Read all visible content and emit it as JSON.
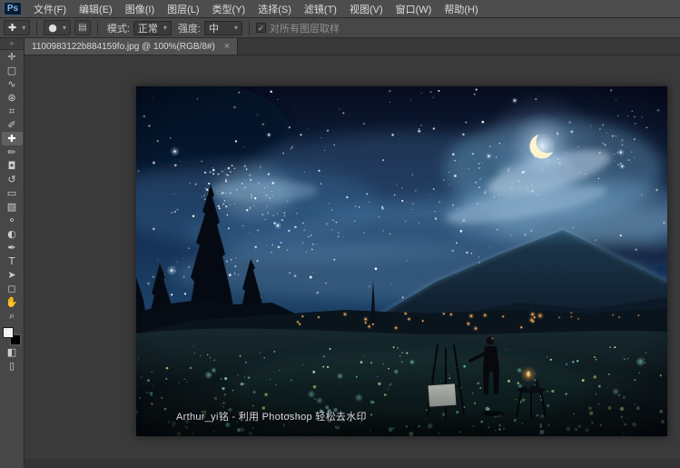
{
  "app": {
    "name": "Adobe Photoshop",
    "logo": "Ps"
  },
  "colors": {
    "menubar": "#4d4d4d",
    "panel": "#474747",
    "pasteboard": "#3a3a3a",
    "accent_blue": "#7ab8f5",
    "night_sky": "#12294d",
    "moon": "#fef3cf",
    "village_light": "#ffb160",
    "flower_teal": "#7fd8c4"
  },
  "menubar": {
    "items": [
      {
        "id": "file",
        "label": "文件(F)"
      },
      {
        "id": "edit",
        "label": "编辑(E)"
      },
      {
        "id": "image",
        "label": "图像(I)"
      },
      {
        "id": "layer",
        "label": "图层(L)"
      },
      {
        "id": "type",
        "label": "类型(Y)"
      },
      {
        "id": "select",
        "label": "选择(S)"
      },
      {
        "id": "filter",
        "label": "滤镜(T)"
      },
      {
        "id": "view",
        "label": "视图(V)"
      },
      {
        "id": "window",
        "label": "窗口(W)"
      },
      {
        "id": "help",
        "label": "帮助(H)"
      }
    ]
  },
  "optionsbar": {
    "preset_glyph": "✚",
    "chevron_glyph": "▾",
    "brush_picker_glyph": "●",
    "panel_toggle_glyph": "▤",
    "mode_label": "模式:",
    "mode_value": "正常",
    "strength_label": "强度:",
    "strength_value": "中",
    "check_glyph": "✓",
    "sample_check_label": "对所有图层取样"
  },
  "tabbar": {
    "title": "1100983122b884159fo.jpg @ 100%(RGB/8#)",
    "close_glyph": "×"
  },
  "toolbar": {
    "collapse_glyph": "»",
    "quick_mask_glyph": "◧",
    "screen_mode_glyph": "▯",
    "tools": [
      {
        "id": "move-tool",
        "glyph": "✛"
      },
      {
        "id": "marquee-tool",
        "glyph": "▢"
      },
      {
        "id": "lasso-tool",
        "glyph": "∿"
      },
      {
        "id": "quick-selection-tool",
        "glyph": "⊛"
      },
      {
        "id": "crop-tool",
        "glyph": "⌗"
      },
      {
        "id": "eyedropper-tool",
        "glyph": "✐"
      },
      {
        "id": "spot-healing-brush-tool",
        "glyph": "✚",
        "selected": true
      },
      {
        "id": "brush-tool",
        "glyph": "✏"
      },
      {
        "id": "clone-stamp-tool",
        "glyph": "◘"
      },
      {
        "id": "history-brush-tool",
        "glyph": "↺"
      },
      {
        "id": "eraser-tool",
        "glyph": "▭"
      },
      {
        "id": "gradient-tool",
        "glyph": "▨"
      },
      {
        "id": "blur-tool",
        "glyph": "⚬"
      },
      {
        "id": "dodge-tool",
        "glyph": "◐"
      },
      {
        "id": "pen-tool",
        "glyph": "✒"
      },
      {
        "id": "type-tool",
        "glyph": "T"
      },
      {
        "id": "path-selection-tool",
        "glyph": "➤"
      },
      {
        "id": "rectangle-tool",
        "glyph": "◻"
      },
      {
        "id": "hand-tool",
        "glyph": "✋"
      },
      {
        "id": "zoom-tool",
        "glyph": "⌕"
      }
    ]
  },
  "canvas": {
    "watermark": "Arthur_yi铭 - 利用 Photoshop 轻松去水印"
  }
}
